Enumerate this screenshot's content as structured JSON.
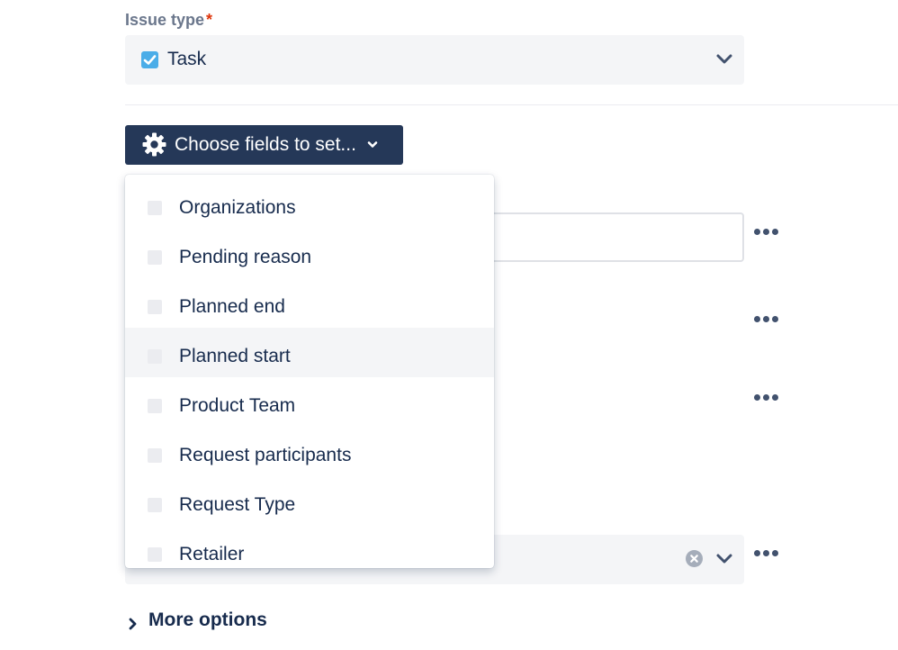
{
  "issue_type": {
    "label": "Issue type",
    "required_marker": "*",
    "value": "Task"
  },
  "choose_fields": {
    "label": "Choose fields to set..."
  },
  "dropdown": {
    "items": [
      {
        "label": "Organizations"
      },
      {
        "label": "Pending reason"
      },
      {
        "label": "Planned end"
      },
      {
        "label": "Planned start"
      },
      {
        "label": "Product Team"
      },
      {
        "label": "Request participants"
      },
      {
        "label": "Request Type"
      },
      {
        "label": "Retailer"
      }
    ],
    "hovered_item": "Planned start"
  },
  "more_options": {
    "label": "More options"
  },
  "colors": {
    "button_bg": "#253858",
    "task_icon": "#4bade8",
    "required": "#de350b"
  }
}
